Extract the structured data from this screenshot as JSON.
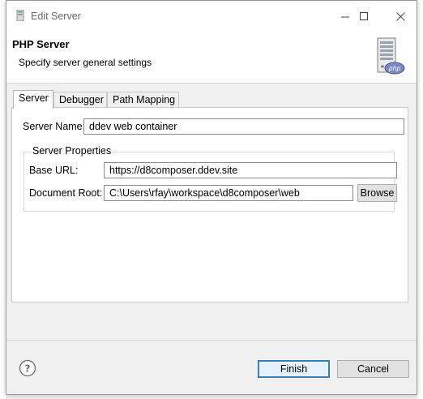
{
  "window": {
    "title": "Edit Server"
  },
  "header": {
    "title": "PHP Server",
    "subtitle": "Specify server general settings",
    "icon": "php-server-icon"
  },
  "tabs": [
    {
      "label": "Server",
      "active": true
    },
    {
      "label": "Debugger",
      "active": false
    },
    {
      "label": "Path Mapping",
      "active": false
    }
  ],
  "server_tab": {
    "name_label": "Server Name:",
    "name_value": "ddev web container",
    "properties": {
      "legend": "Server Properties",
      "base_url_label": "Base URL:",
      "base_url_value": "https://d8composer.ddev.site",
      "doc_root_label": "Document Root:",
      "doc_root_value": "C:\\Users\\rfay\\workspace\\d8composer\\web",
      "browse_label": "Browse"
    }
  },
  "footer": {
    "finish_label": "Finish",
    "cancel_label": "Cancel"
  },
  "colors": {
    "accent": "#3c7fb1",
    "header_bg": "#ffffff",
    "dialog_bg": "#f0f0f0"
  }
}
